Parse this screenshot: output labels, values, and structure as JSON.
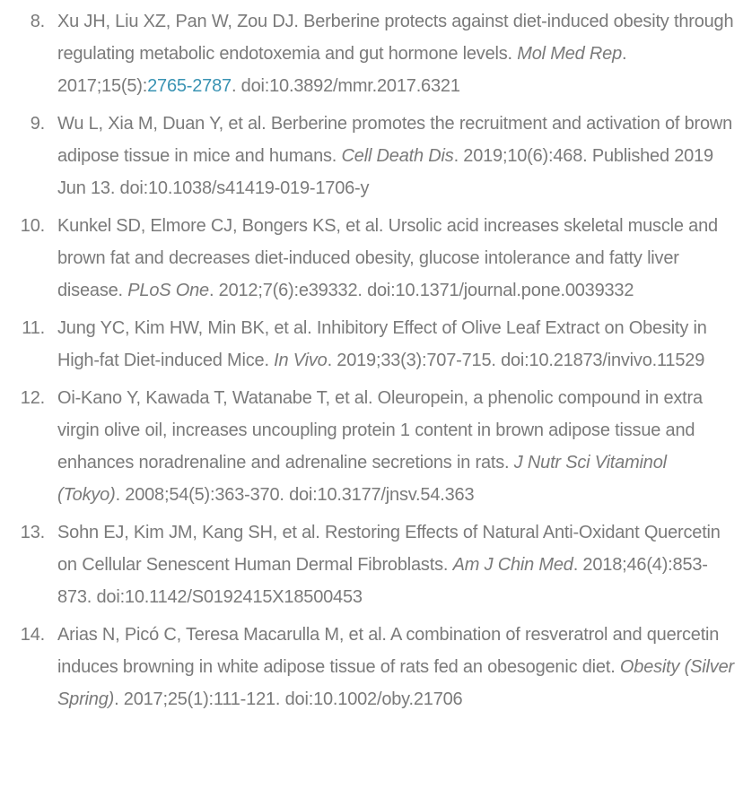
{
  "references": [
    {
      "number": "8.",
      "pre": "Xu JH, Liu XZ, Pan W, Zou DJ. Berberine protects against diet-induced obesity through regulating metabolic endotoxemia and gut hormone levels. ",
      "journal": "Mol Med Rep",
      "mid": ". 2017;15(5):",
      "link": "2765-2787",
      "post": ". doi:10.3892/mmr.2017.6321"
    },
    {
      "number": "9.",
      "pre": "Wu L, Xia M, Duan Y, et al. Berberine promotes the recruitment and activation of brown adipose tissue in mice and humans. ",
      "journal": "Cell Death Dis",
      "post": ". 2019;10(6):468. Published 2019 Jun 13. doi:10.1038/s41419-019-1706-y"
    },
    {
      "number": "10.",
      "pre": "Kunkel SD, Elmore CJ, Bongers KS, et al. Ursolic acid increases skeletal muscle and brown fat and decreases diet-induced obesity, glucose intolerance and fatty liver disease. ",
      "journal": "PLoS One",
      "post": ". 2012;7(6):e39332. doi:10.1371/journal.pone.0039332"
    },
    {
      "number": "11.",
      "pre": "Jung YC, Kim HW, Min BK, et al. Inhibitory Effect of Olive Leaf Extract on Obesity in High-fat Diet-induced Mice. ",
      "journal": "In Vivo",
      "post": ". 2019;33(3):707-715. doi:10.21873/invivo.11529"
    },
    {
      "number": "12.",
      "pre": "Oi-Kano Y, Kawada T, Watanabe T, et al. Oleuropein, a phenolic compound in extra virgin olive oil, increases uncoupling protein 1 content in brown adipose tissue and enhances noradrenaline and adrenaline secretions in rats. ",
      "journal": "J Nutr Sci Vitaminol (Tokyo)",
      "post": ". 2008;54(5):363-370. doi:10.3177/jnsv.54.363"
    },
    {
      "number": "13.",
      "pre": "Sohn EJ, Kim JM, Kang SH, et al. Restoring Effects of Natural Anti-Oxidant Quercetin on Cellular Senescent Human Dermal Fibroblasts. ",
      "journal": "Am J Chin Med",
      "post": ". 2018;46(4):853-873. doi:10.1142/S0192415X18500453"
    },
    {
      "number": "14.",
      "pre": "Arias N, Picó C, Teresa Macarulla M, et al. A combination of resveratrol and quercetin induces browning in white adipose tissue of rats fed an obesogenic diet. ",
      "journal": "Obesity (Silver Spring)",
      "post": ". 2017;25(1):111-121. doi:10.1002/oby.21706"
    }
  ]
}
